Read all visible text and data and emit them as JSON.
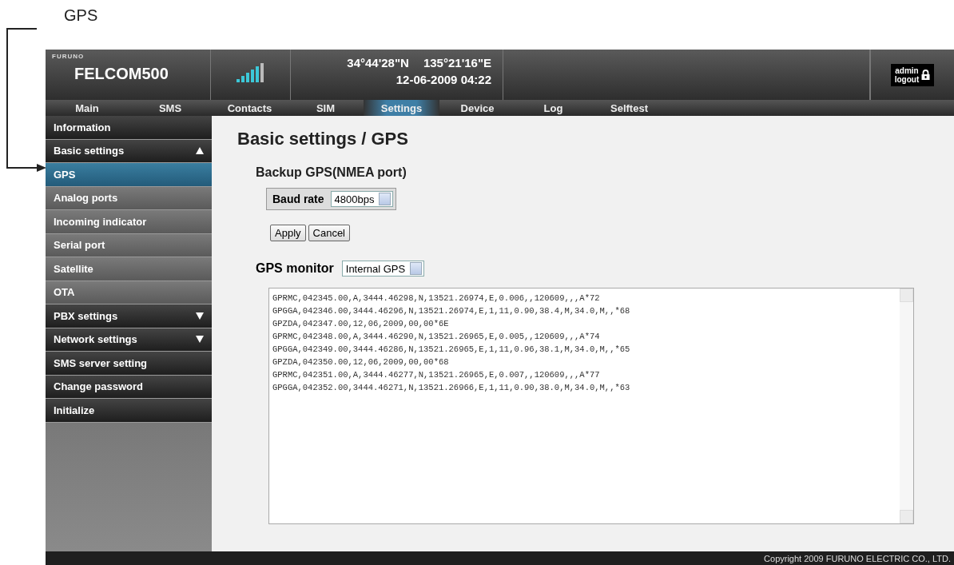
{
  "callout": {
    "label": "GPS"
  },
  "header": {
    "brand": "FURUNO",
    "product": "FELCOM500",
    "latitude": "34°44'28\"N",
    "longitude": "135°21'16\"E",
    "datetime": "12-06-2009 04:22",
    "user": "admin",
    "logout": "logout"
  },
  "tabs": [
    {
      "label": "Main",
      "selected": false
    },
    {
      "label": "SMS",
      "selected": false
    },
    {
      "label": "Contacts",
      "selected": false
    },
    {
      "label": "SIM",
      "selected": false
    },
    {
      "label": "Settings",
      "selected": true
    },
    {
      "label": "Device",
      "selected": false
    },
    {
      "label": "Log",
      "selected": false
    },
    {
      "label": "Selftest",
      "selected": false
    }
  ],
  "sidebar": {
    "items": [
      {
        "label": "Information",
        "kind": "section",
        "selected": false
      },
      {
        "label": "Basic settings",
        "kind": "section",
        "selected": false,
        "expanded": true
      },
      {
        "label": "GPS",
        "kind": "sub",
        "selected": true
      },
      {
        "label": "Analog ports",
        "kind": "sub",
        "selected": false
      },
      {
        "label": "Incoming indicator",
        "kind": "sub",
        "selected": false
      },
      {
        "label": "Serial port",
        "kind": "sub",
        "selected": false
      },
      {
        "label": "Satellite",
        "kind": "sub",
        "selected": false
      },
      {
        "label": "OTA",
        "kind": "sub",
        "selected": false
      },
      {
        "label": "PBX settings",
        "kind": "section",
        "selected": false,
        "expanded": false
      },
      {
        "label": "Network settings",
        "kind": "section",
        "selected": false,
        "expanded": false
      },
      {
        "label": "SMS server setting",
        "kind": "section",
        "selected": false
      },
      {
        "label": "Change password",
        "kind": "section",
        "selected": false
      },
      {
        "label": "Initialize",
        "kind": "section",
        "selected": false
      }
    ]
  },
  "content": {
    "title": "Basic settings / GPS",
    "backup_heading": "Backup GPS(NMEA port)",
    "baud_label": "Baud rate",
    "baud_value": "4800bps",
    "buttons": [
      "Apply",
      "Cancel"
    ],
    "monitor_label": "GPS monitor",
    "monitor_source": "Internal GPS",
    "monitor_lines": [
      "GPRMC,042345.00,A,3444.46298,N,13521.26974,E,0.006,,120609,,,A*72",
      "GPGGA,042346.00,3444.46296,N,13521.26974,E,1,11,0.90,38.4,M,34.0,M,,*68",
      "GPZDA,042347.00,12,06,2009,00,00*6E",
      "GPRMC,042348.00,A,3444.46290,N,13521.26965,E,0.005,,120609,,,A*74",
      "GPGGA,042349.00,3444.46286,N,13521.26965,E,1,11,0.96,38.1,M,34.0,M,,*65",
      "GPZDA,042350.00,12,06,2009,00,00*68",
      "GPRMC,042351.00,A,3444.46277,N,13521.26965,E,0.007,,120609,,,A*77",
      "GPGGA,042352.00,3444.46271,N,13521.26966,E,1,11,0.90,38.0,M,34.0,M,,*63"
    ]
  },
  "footer": {
    "copyright": "Copyright 2009 FURUNO ELECTRIC CO., LTD."
  }
}
